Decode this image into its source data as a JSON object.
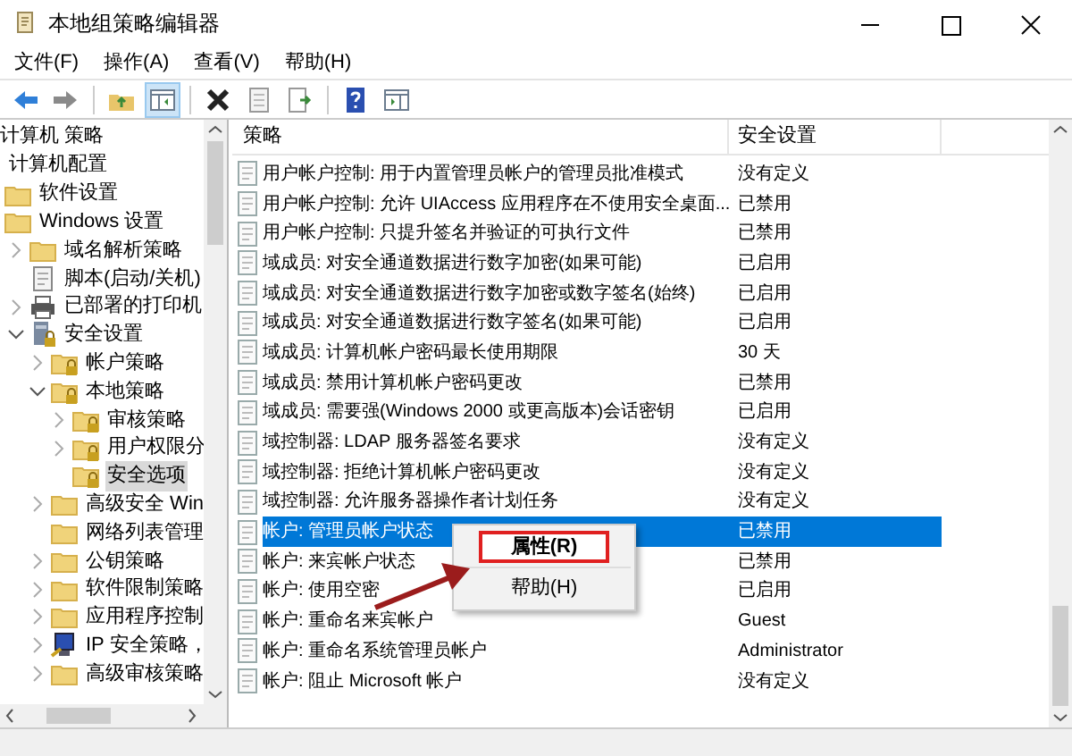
{
  "window": {
    "title": "本地组策略编辑器"
  },
  "menu": [
    "文件(F)",
    "操作(A)",
    "查看(V)",
    "帮助(H)"
  ],
  "toolbar": [
    {
      "kind": "back"
    },
    {
      "kind": "forward"
    },
    {
      "kind": "sep"
    },
    {
      "kind": "up"
    },
    {
      "kind": "pane",
      "selected": true
    },
    {
      "kind": "sep"
    },
    {
      "kind": "delete"
    },
    {
      "kind": "props"
    },
    {
      "kind": "export"
    },
    {
      "kind": "sep"
    },
    {
      "kind": "help"
    },
    {
      "kind": "pane2"
    }
  ],
  "tree": {
    "header": "计算机 策略",
    "items": [
      {
        "label": "计算机配置",
        "children": [
          {
            "label": "软件设置",
            "kind": "folder"
          },
          {
            "label": "Windows 设置",
            "kind": "folder",
            "children": [
              {
                "label": "域名解析策略",
                "kind": "folder",
                "expanded": false
              },
              {
                "label": "脚本(启动/关机)",
                "kind": "script"
              },
              {
                "label": "已部署的打印机",
                "kind": "printer",
                "expanded": false
              },
              {
                "label": "安全设置",
                "kind": "secure",
                "expanded": true,
                "children": [
                  {
                    "label": "帐户策略",
                    "kind": "lockfolder",
                    "expanded": false
                  },
                  {
                    "label": "本地策略",
                    "kind": "lockfolder",
                    "expanded": true,
                    "children": [
                      {
                        "label": "审核策略",
                        "kind": "lockfolder",
                        "expanded": false
                      },
                      {
                        "label": "用户权限分",
                        "kind": "lockfolder",
                        "expanded": false
                      },
                      {
                        "label": "安全选项",
                        "kind": "lockfolder",
                        "selected": true
                      }
                    ]
                  },
                  {
                    "label": "高级安全 Win",
                    "kind": "folder",
                    "expanded": false
                  },
                  {
                    "label": "网络列表管理",
                    "kind": "folder"
                  },
                  {
                    "label": "公钥策略",
                    "kind": "folder",
                    "expanded": false
                  },
                  {
                    "label": "软件限制策略",
                    "kind": "folder",
                    "expanded": false
                  },
                  {
                    "label": "应用程序控制",
                    "kind": "folder",
                    "expanded": false
                  },
                  {
                    "label": "IP 安全策略，",
                    "kind": "computer",
                    "expanded": false
                  },
                  {
                    "label": "高级审核策略",
                    "kind": "folder",
                    "expanded": false
                  }
                ]
              }
            ]
          }
        ]
      }
    ]
  },
  "table": {
    "columns": [
      "策略",
      "安全设置"
    ],
    "rows": [
      {
        "policy": "用户帐户控制: 用于内置管理员帐户的管理员批准模式",
        "setting": "没有定义",
        "selected": false
      },
      {
        "policy": "用户帐户控制: 允许 UIAccess 应用程序在不使用安全桌面...",
        "setting": "已禁用",
        "selected": false
      },
      {
        "policy": "用户帐户控制: 只提升签名并验证的可执行文件",
        "setting": "已禁用",
        "selected": false
      },
      {
        "policy": "域成员: 对安全通道数据进行数字加密(如果可能)",
        "setting": "已启用",
        "selected": false
      },
      {
        "policy": "域成员: 对安全通道数据进行数字加密或数字签名(始终)",
        "setting": "已启用",
        "selected": false
      },
      {
        "policy": "域成员: 对安全通道数据进行数字签名(如果可能)",
        "setting": "已启用",
        "selected": false
      },
      {
        "policy": "域成员: 计算机帐户密码最长使用期限",
        "setting": "30 天",
        "selected": false
      },
      {
        "policy": "域成员: 禁用计算机帐户密码更改",
        "setting": "已禁用",
        "selected": false
      },
      {
        "policy": "域成员: 需要强(Windows 2000 或更高版本)会话密钥",
        "setting": "已启用",
        "selected": false
      },
      {
        "policy": "域控制器: LDAP 服务器签名要求",
        "setting": "没有定义",
        "selected": false
      },
      {
        "policy": "域控制器: 拒绝计算机帐户密码更改",
        "setting": "没有定义",
        "selected": false
      },
      {
        "policy": "域控制器: 允许服务器操作者计划任务",
        "setting": "没有定义",
        "selected": false
      },
      {
        "policy": "帐户: 管理员帐户状态",
        "setting": "已禁用",
        "selected": true
      },
      {
        "policy": "帐户: 来宾帐户状态",
        "setting": "已禁用",
        "selected": false
      },
      {
        "policy": "帐户: 使用空密",
        "setting": "已启用",
        "selected": false
      },
      {
        "policy": "帐户: 重命名来宾帐户",
        "setting": "Guest",
        "selected": false
      },
      {
        "policy": "帐户: 重命名系统管理员帐户",
        "setting": "Administrator",
        "selected": false
      },
      {
        "policy": "帐户: 阻止 Microsoft 帐户",
        "setting": "没有定义",
        "selected": false
      }
    ]
  },
  "context_menu": {
    "items": [
      {
        "label": "属性(R)",
        "highlighted": true
      },
      {
        "label": "帮助(H)",
        "highlighted": false
      }
    ]
  }
}
